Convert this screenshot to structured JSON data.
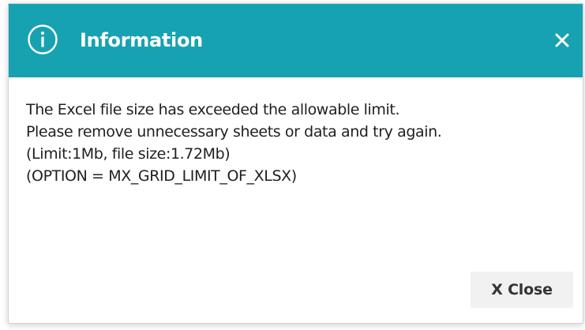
{
  "dialog": {
    "title": "Information",
    "icon": "info-circle-icon",
    "close_icon": "close-icon",
    "accent_color": "#17a2b1",
    "message_lines": [
      "The Excel file size has exceeded the allowable limit.",
      "Please remove unnecessary sheets or data and try again.",
      "(Limit:1Mb, file size:1.72Mb)",
      "(OPTION = MX_GRID_LIMIT_OF_XLSX)"
    ],
    "close_button_label": "X Close"
  }
}
